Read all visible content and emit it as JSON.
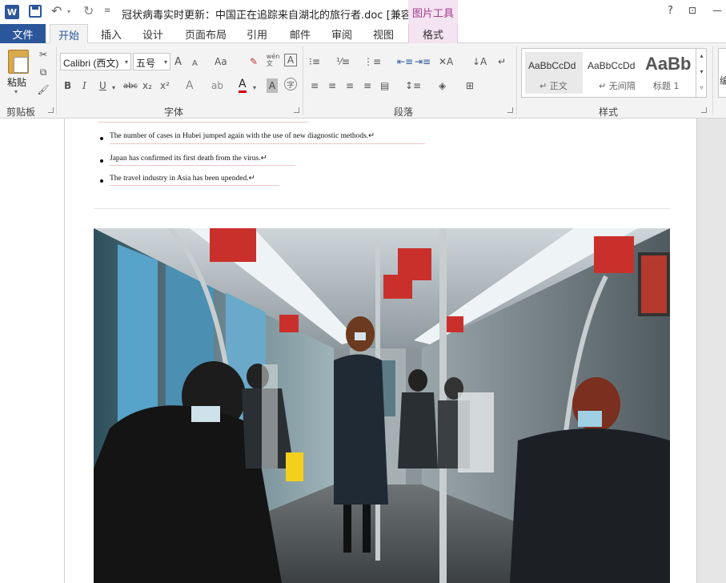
{
  "title_bar": {
    "app_logo": "W",
    "document_title": "冠状病毒实时更新：中国正在追踪来自湖北的旅行者.doc [兼容...",
    "contextual_tool_label": "图片工具",
    "help": "?"
  },
  "tabs": {
    "file": "文件",
    "home": "开始",
    "insert": "插入",
    "design": "设计",
    "page_layout": "页面布局",
    "references": "引用",
    "mailings": "邮件",
    "review": "审阅",
    "view": "视图",
    "format": "格式"
  },
  "ribbon": {
    "clipboard": {
      "paste": "粘贴",
      "group_label": "剪贴板"
    },
    "font": {
      "font_name": "Calibri (西文)",
      "font_size": "五号",
      "group_label": "字体",
      "phonetic": "wén 文",
      "bold": "B",
      "italic": "I",
      "underline": "U",
      "strikethrough": "abc",
      "subscript": "x₂",
      "superscript": "x²",
      "grow": "A",
      "shrink": "A",
      "change_case": "Aa",
      "text_effect": "A",
      "font_color": "A",
      "char_shading": "A",
      "enclose": "字"
    },
    "paragraph": {
      "group_label": "段落"
    },
    "styles": {
      "group_label": "样式",
      "items": [
        {
          "sample": "AaBbCcDd",
          "name": "↵ 正文"
        },
        {
          "sample": "AaBbCcDd",
          "name": "↵ 无间隔"
        },
        {
          "sample": "AaBb",
          "name": "标题 1"
        }
      ]
    },
    "editing_fragment": "编"
  },
  "document": {
    "bullets": [
      "The number of cases in Hubei jumped again with the use of new diagnostic methods.↵",
      "Japan has confirmed its first death from the virus.↵",
      "The travel industry in Asia has been upended.↵"
    ]
  },
  "colors": {
    "word_blue": "#2b579a",
    "picture_tools_pink": "#f4e3f0",
    "picture_tools_text": "#a23c8e"
  }
}
